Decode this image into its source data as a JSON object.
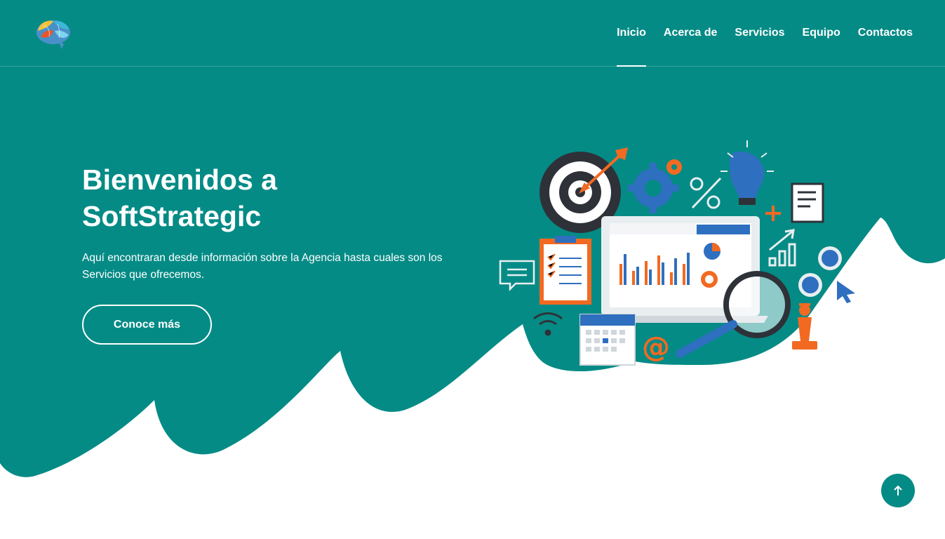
{
  "brand": {
    "logo_icon": "brain-logo-icon"
  },
  "nav": {
    "items": [
      {
        "label": "Inicio",
        "active": true
      },
      {
        "label": "Acerca de",
        "active": false
      },
      {
        "label": "Servicios",
        "active": false
      },
      {
        "label": "Equipo",
        "active": false
      },
      {
        "label": "Contactos",
        "active": false
      }
    ]
  },
  "hero": {
    "title": "Bienvenidos a SoftStrategic",
    "description": "Aquí encontraran desde información sobre la Agencia hasta cuales son los Servicios que ofrecemos.",
    "cta_label": "Conoce más",
    "illustration_icon": "marketing-analytics-illustration"
  },
  "back_to_top": {
    "icon": "arrow-up-icon"
  },
  "colors": {
    "primary": "#058b86",
    "accent_orange": "#f26a21",
    "accent_blue": "#2e6fbf",
    "dark": "#2e3238",
    "background": "#ffffff"
  }
}
